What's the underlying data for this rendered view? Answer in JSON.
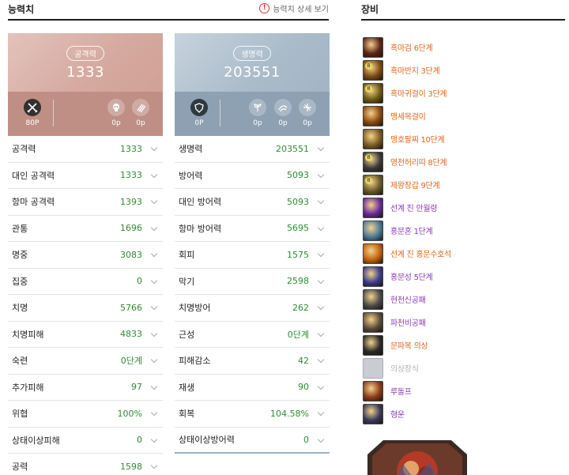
{
  "stats_panel": {
    "title": "능력치",
    "detail_link": "능력치 상세 보기",
    "attack_card": {
      "label": "공격력",
      "value": "1333",
      "icons": [
        {
          "name": "crossed-swords-icon",
          "value": "80P"
        },
        {
          "name": "skull-icon",
          "value": "0p"
        },
        {
          "name": "claw-icon",
          "value": "0p"
        }
      ]
    },
    "hp_card": {
      "label": "생명력",
      "value": "203551",
      "icons": [
        {
          "name": "shield-icon",
          "value": "0P"
        },
        {
          "name": "sprout-icon",
          "value": "0p"
        },
        {
          "name": "dash-icon",
          "value": "0p"
        },
        {
          "name": "sparkle-icon",
          "value": "0p"
        }
      ]
    },
    "left_stats": [
      {
        "label": "공격력",
        "value": "1333"
      },
      {
        "label": "대인 공격력",
        "value": "1333"
      },
      {
        "label": "항마 공격력",
        "value": "1393"
      },
      {
        "label": "관통",
        "value": "1696"
      },
      {
        "label": "명중",
        "value": "3083"
      },
      {
        "label": "집중",
        "value": "0"
      },
      {
        "label": "치명",
        "value": "5766"
      },
      {
        "label": "치명피해",
        "value": "4833"
      },
      {
        "label": "숙련",
        "value": "0단계"
      },
      {
        "label": "추가피해",
        "value": "97"
      },
      {
        "label": "위협",
        "value": "100%"
      },
      {
        "label": "상태이상피해",
        "value": "0"
      },
      {
        "label": "공력",
        "value": "1598"
      }
    ],
    "right_stats": [
      {
        "label": "생명력",
        "value": "203551"
      },
      {
        "label": "방어력",
        "value": "5093"
      },
      {
        "label": "대인 방어력",
        "value": "5093"
      },
      {
        "label": "항마 방어력",
        "value": "5695"
      },
      {
        "label": "회피",
        "value": "1575"
      },
      {
        "label": "막기",
        "value": "2598"
      },
      {
        "label": "치명방어",
        "value": "262"
      },
      {
        "label": "근성",
        "value": "0단계"
      },
      {
        "label": "피해감소",
        "value": "42"
      },
      {
        "label": "재생",
        "value": "90"
      },
      {
        "label": "회복",
        "value": "104.58%"
      },
      {
        "label": "상태이상방어력",
        "value": "0"
      }
    ]
  },
  "equipment": {
    "title": "장비",
    "items": [
      {
        "name": "흑마검 6단계",
        "color": "orange",
        "icon_color": "#5a2418",
        "icon": "sword-icon"
      },
      {
        "name": "흑마반지 3단계",
        "color": "orange",
        "icon_color": "#7a4a12",
        "icon": "ring-icon",
        "badge": "8"
      },
      {
        "name": "흑마귀걸이 3단계",
        "color": "orange",
        "icon_color": "#6b5a14",
        "icon": "earring-icon",
        "badge": "8"
      },
      {
        "name": "맹세목걸이",
        "color": "orange",
        "icon_color": "#8a4a10",
        "icon": "necklace-icon"
      },
      {
        "name": "맹호팔찌 10단계",
        "color": "orange",
        "icon_color": "#7a5a22",
        "icon": "bracelet-icon"
      },
      {
        "name": "영천허리띠 8단계",
        "color": "orange",
        "icon_color": "#3a3a3a",
        "icon": "belt-icon",
        "badge": "8"
      },
      {
        "name": "제왕장갑 9단계",
        "color": "orange",
        "icon_color": "#6a5a2a",
        "icon": "glove-icon",
        "badge": "8"
      },
      {
        "name": "선계 진 만월령",
        "color": "purple",
        "icon_color": "#6a2a9a",
        "icon": "moon-orb-icon"
      },
      {
        "name": "홍문혼 1단계",
        "color": "purple",
        "icon_color": "#4a7a9a",
        "icon": "soul-icon"
      },
      {
        "name": "선계 진 홍문수호석",
        "color": "orange",
        "icon_color": "#c26012",
        "icon": "guard-stone-icon"
      },
      {
        "name": "홍문성 5단계",
        "color": "purple",
        "icon_color": "#3a3a8a",
        "icon": "star-icon"
      },
      {
        "name": "현천신공패",
        "color": "purple",
        "icon_color": "#4a4a4a",
        "icon": "tablet-icon"
      },
      {
        "name": "파천비공패",
        "color": "purple",
        "icon_color": "#5a4a3a",
        "icon": "tablet-icon"
      },
      {
        "name": "문파복 의상",
        "color": "orange",
        "icon_color": "#2a2a2a",
        "icon": "costume-icon"
      },
      {
        "name": "의상장식",
        "color": "gray",
        "icon_color": "#c9ccd0",
        "icon": "empty-slot-icon",
        "empty": true
      },
      {
        "name": "루돌프",
        "color": "purple",
        "icon_color": "#8a3a1a",
        "icon": "reindeer-icon"
      },
      {
        "name": "형운",
        "color": "purple",
        "icon_color": "#3a3a5a",
        "icon": "cloud-icon"
      }
    ]
  }
}
